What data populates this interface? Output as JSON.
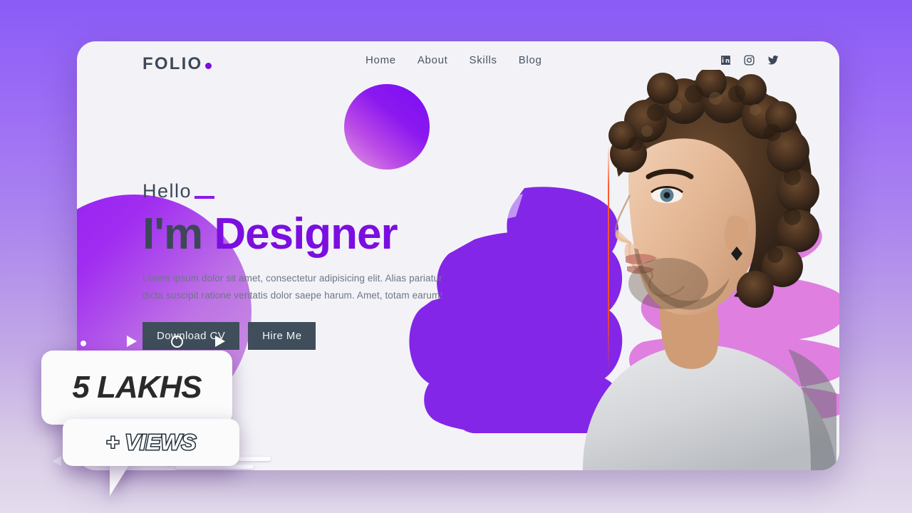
{
  "background": {
    "top_color": "#8b5cf6",
    "bottom_color": "#e4dced"
  },
  "card": {
    "background_color": "#f3f3f7"
  },
  "header": {
    "logo_text": "FOLIO",
    "logo_dot_color": "#7c0ee0",
    "nav": [
      {
        "label": "Home"
      },
      {
        "label": "About"
      },
      {
        "label": "Skills"
      },
      {
        "label": "Blog"
      }
    ],
    "socials": [
      {
        "name": "linkedin-icon"
      },
      {
        "name": "instagram-icon"
      },
      {
        "name": "twitter-icon"
      }
    ]
  },
  "hero": {
    "greeting": "Hello",
    "headline_dark": "I'm",
    "headline_accent": "Designer",
    "headline_accent_color": "#7c0ee0",
    "lead": "Lorem ipsum dolor sit amet, consectetur adipisicing elit. Alias pariatur dicta suscipit ratione veritatis dolor saepe harum. Amet, totam earum!",
    "buttons": [
      {
        "label": "Download CV"
      },
      {
        "label": "Hire Me"
      }
    ],
    "button_color": "#3f4e5a"
  },
  "decorations": {
    "gradient_circle": "purple-gradient-circle",
    "blob": "purple-gradient-blob",
    "brush_purple": "purple-brush-stroke",
    "brush_pink": "pink-brush-stroke",
    "accent_line": "red-vertical-accent-line"
  },
  "photo": {
    "alt": "portrait of a man with curly hair in a white t-shirt"
  },
  "views_badge": {
    "count_text": "5 LAKHS",
    "views_text": "+ VIEWS"
  }
}
